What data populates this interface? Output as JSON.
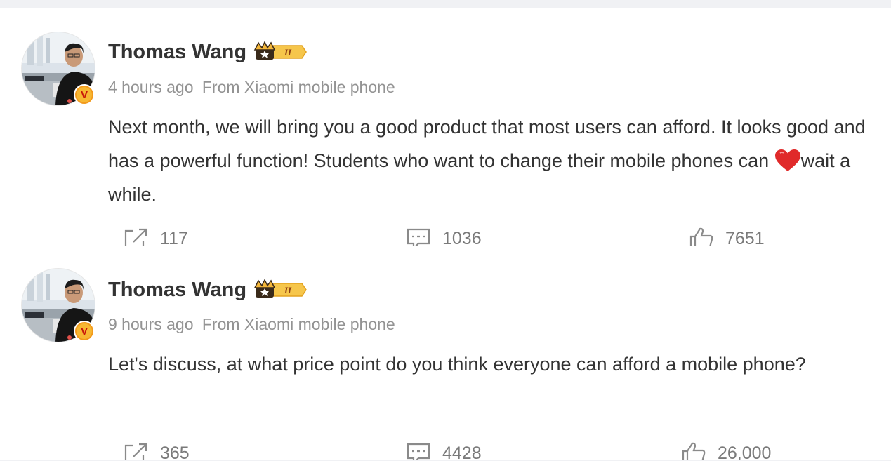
{
  "posts": [
    {
      "username": "Thomas Wang",
      "time": "4 hours ago",
      "source": "From Xiaomi mobile phone",
      "content_before_emoji": "Next month, we will bring you a good product that most users can afford. It looks good and has a powerful function! Students who want to change their mobile phones can ",
      "content_after_emoji": "wait a while.",
      "emoji": "red-heart",
      "reposts": "117",
      "comments": "1036",
      "likes": "7651",
      "vip_level": "II"
    },
    {
      "username": "Thomas Wang",
      "time": "9 hours ago",
      "source": "From Xiaomi mobile phone",
      "content": "Let's discuss, at what price point do you think everyone can afford a mobile phone?",
      "reposts": "365",
      "comments": "4428",
      "likes": "26,000",
      "vip_level": "II"
    }
  ],
  "verified_badge_letter": "V",
  "colors": {
    "text_primary": "#333333",
    "text_meta": "#939393",
    "action_gray": "#7a7a7a",
    "badge_gold": "#f7b732",
    "badge_red": "#c8150a",
    "heart_red": "#e02a2a",
    "page_background_strip": "#f0f1f4"
  },
  "icons": {
    "repost": "repost-icon",
    "comment": "comment-icon",
    "like": "thumbs-up-icon",
    "vip": "crown-vip-badge-icon",
    "verified": "verified-v-badge-icon"
  }
}
